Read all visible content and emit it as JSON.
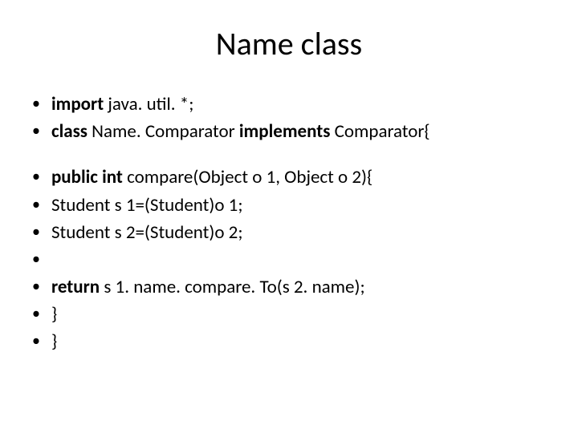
{
  "title": "Name class",
  "group1": {
    "line1": {
      "bold": "import",
      "rest": " java. util. *;"
    },
    "line2": {
      "bold1": "class",
      "mid": " Name. Comparator ",
      "bold2": "implements",
      "rest": " Comparator{"
    }
  },
  "group2": {
    "line1": {
      "bold": "public int",
      "rest": " compare(Object o 1, Object o 2){"
    },
    "line2": "Student s 1=(Student)o 1;",
    "line3": "Student s 2=(Student)o 2;",
    "line5": {
      "bold": "return",
      "rest": " s 1. name. compare. To(s 2. name);"
    },
    "line6": "}",
    "line7": "}"
  }
}
